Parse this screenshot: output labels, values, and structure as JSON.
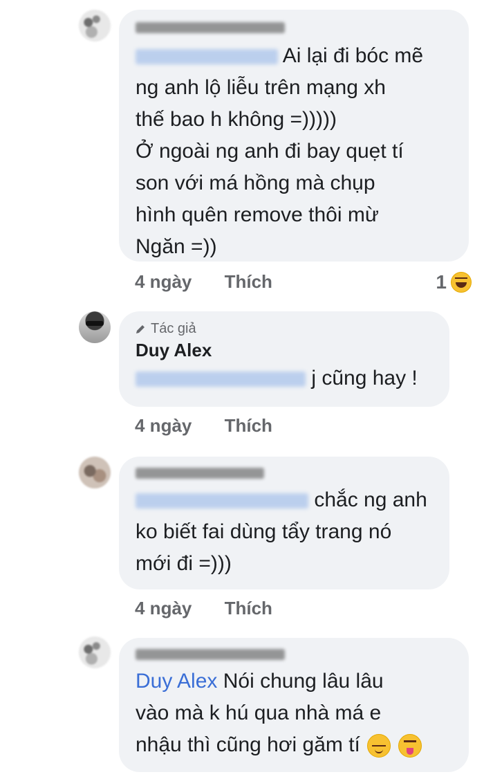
{
  "comments": [
    {
      "text_lines": [
        "Ai lại đi bóc mẽ",
        "ng anh lộ liễu trên mạng xh",
        "thế bao h không =)))))",
        "Ở ngoài ng anh đi bay quẹt tí",
        "son với má hồng mà chụp",
        "hình quên remove thôi mừ",
        "Ngăn =))"
      ],
      "time": "4 ngày",
      "like": "Thích",
      "reaction_count": "1",
      "reaction_icon": "laugh-emoji-icon"
    },
    {
      "author_badge": "Tác giả",
      "author": "Duy Alex",
      "text": "j cũng hay !",
      "time": "4 ngày",
      "like": "Thích"
    },
    {
      "text_lines": [
        "chắc ng anh",
        "ko biết fai dùng tẩy trang nó",
        "mới đi =)))"
      ],
      "time": "4 ngày",
      "like": "Thích"
    },
    {
      "mention": "Duy Alex",
      "text_lines": [
        "Nói chung lâu lâu",
        "vào mà k hú qua nhà má e",
        "nhậu thì cũng hơi găm tí"
      ]
    }
  ],
  "colors": {
    "bubble": "#f0f2f5",
    "mention": "#3a6ed6",
    "meta": "#65676b"
  }
}
